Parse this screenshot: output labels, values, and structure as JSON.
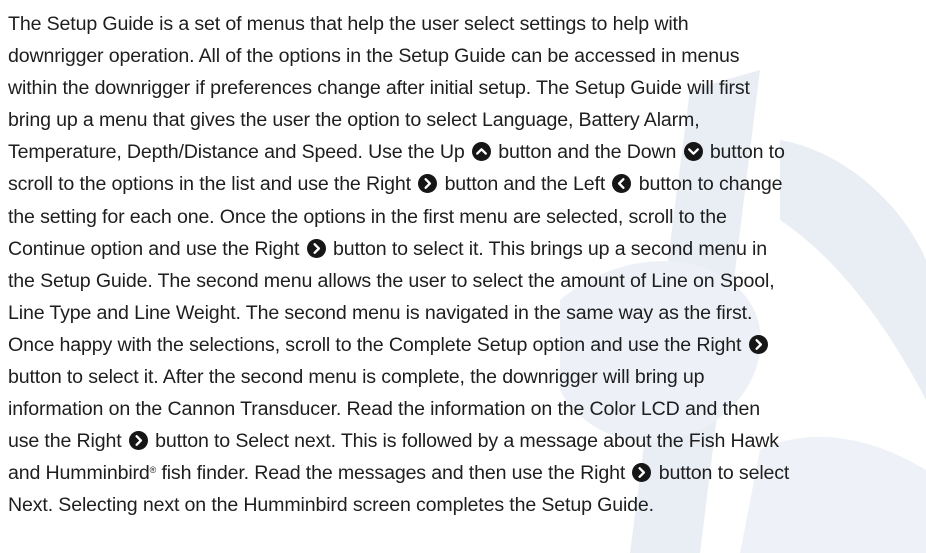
{
  "paragraph": {
    "l1": "The Setup Guide is a set of menus that help the user select settings to help with",
    "l2": "downrigger operation. All of the options in the Setup Guide can be accessed in menus",
    "l3": "within the downrigger if preferences change after initial setup. The Setup Guide will first",
    "l4": "bring up a menu that gives the user the option to select Language, Battery Alarm,",
    "l5a": "Temperature, Depth/Distance and Speed. Use the Up",
    "l5b": "button and the Down",
    "l5c": "button to",
    "l6a": "scroll to the options in the list and use the Right",
    "l6b": "button and the Left",
    "l6c": "button to change",
    "l7": "the setting for each one. Once the options in the first menu are selected, scroll to the",
    "l8a": "Continue option and use the Right",
    "l8b": "button to select it. This brings up a second menu in",
    "l9": "the Setup Guide. The second menu allows the user to select the amount of Line on Spool,",
    "l10": "Line Type and Line Weight. The second menu is navigated in the same way as the first.",
    "l11": "Once happy with the selections, scroll to the Complete Setup option and use the Right",
    "l12": "button to select it. After the second menu is complete, the downrigger will bring up",
    "l13": "information on the Cannon Transducer. Read the information on the Color LCD and then",
    "l14a": "use the Right",
    "l14b": "button to Select next. This is followed by a message about the Fish Hawk",
    "l15a": "and Humminbird",
    "l15sup": "®",
    "l15b": "fish finder. Read the messages and then use the Right",
    "l15c": "button to select",
    "l16": "Next. Selecting next on the Humminbird screen completes the Setup Guide."
  },
  "icons": {
    "up": "up-arrow-button-icon",
    "down": "down-arrow-button-icon",
    "right": "right-arrow-button-icon",
    "left": "left-arrow-button-icon"
  },
  "colors": {
    "text": "#1e1e1e",
    "icon": "#161616",
    "watermark": "#e9edf4"
  }
}
